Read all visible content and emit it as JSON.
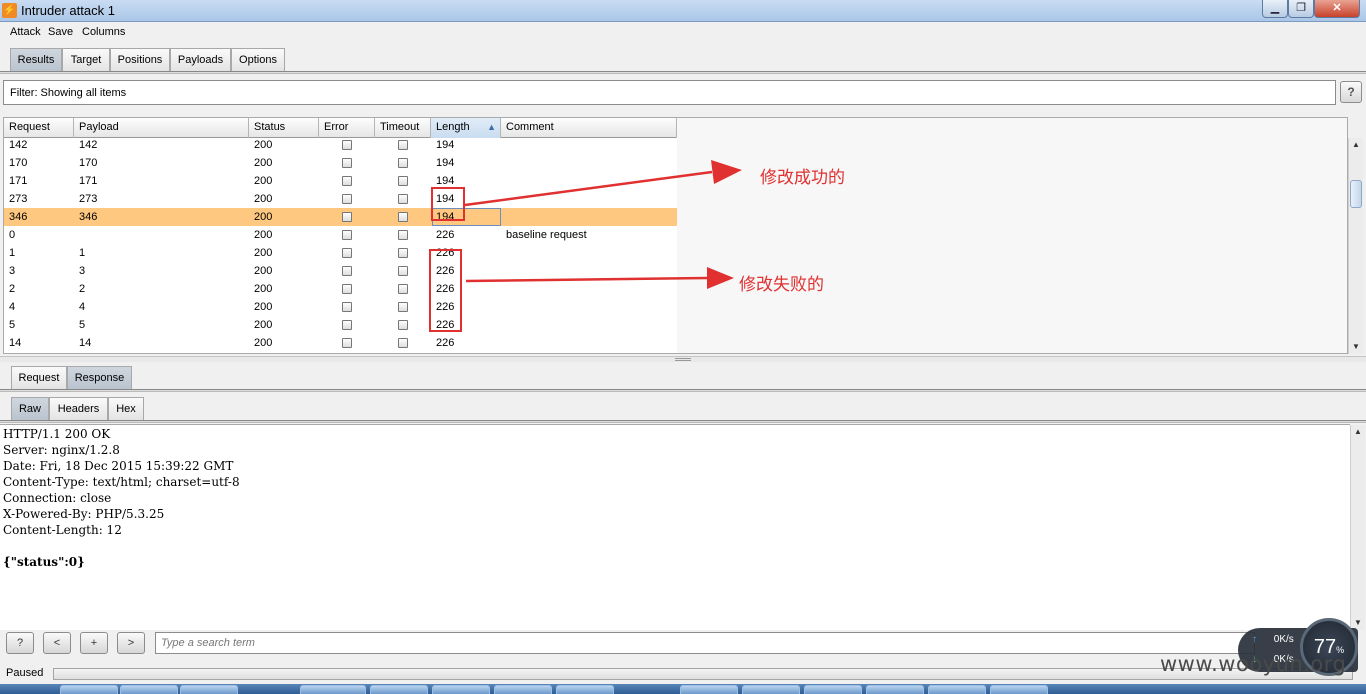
{
  "window": {
    "title": "Intruder attack 1",
    "min_icon": "minimize-icon",
    "max_icon": "maximize-icon",
    "close_icon": "close-icon"
  },
  "menu": [
    "Attack",
    "Save",
    "Columns"
  ],
  "top_tabs": [
    {
      "label": "Results",
      "active": true
    },
    {
      "label": "Target",
      "active": false
    },
    {
      "label": "Positions",
      "active": false
    },
    {
      "label": "Payloads",
      "active": false
    },
    {
      "label": "Options",
      "active": false
    }
  ],
  "filter": {
    "label": "Filter: Showing all items",
    "help": "?"
  },
  "table": {
    "columns": [
      "Request",
      "Payload",
      "Status",
      "Error",
      "Timeout",
      "Length",
      "Comment"
    ],
    "sorted_column": "Length",
    "sort_icon": "sort-ascending-icon",
    "rows": [
      {
        "request": "142",
        "payload": "142",
        "status": "200",
        "length": "194",
        "comment": ""
      },
      {
        "request": "170",
        "payload": "170",
        "status": "200",
        "length": "194",
        "comment": ""
      },
      {
        "request": "171",
        "payload": "171",
        "status": "200",
        "length": "194",
        "comment": ""
      },
      {
        "request": "273",
        "payload": "273",
        "status": "200",
        "length": "194",
        "comment": ""
      },
      {
        "request": "346",
        "payload": "346",
        "status": "200",
        "length": "194",
        "comment": "",
        "selected": true
      },
      {
        "request": "0",
        "payload": "",
        "status": "200",
        "length": "226",
        "comment": "baseline request"
      },
      {
        "request": "1",
        "payload": "1",
        "status": "200",
        "length": "226",
        "comment": ""
      },
      {
        "request": "3",
        "payload": "3",
        "status": "200",
        "length": "226",
        "comment": ""
      },
      {
        "request": "2",
        "payload": "2",
        "status": "200",
        "length": "226",
        "comment": ""
      },
      {
        "request": "4",
        "payload": "4",
        "status": "200",
        "length": "226",
        "comment": ""
      },
      {
        "request": "5",
        "payload": "5",
        "status": "200",
        "length": "226",
        "comment": ""
      },
      {
        "request": "14",
        "payload": "14",
        "status": "200",
        "length": "226",
        "comment": ""
      }
    ]
  },
  "annotations": {
    "success": "修改成功的",
    "fail": "修改失败的",
    "color": "#e03030"
  },
  "detail_tabs": [
    {
      "label": "Request",
      "active": false
    },
    {
      "label": "Response",
      "active": true
    }
  ],
  "view_tabs": [
    {
      "label": "Raw",
      "active": true
    },
    {
      "label": "Headers",
      "active": false
    },
    {
      "label": "Hex",
      "active": false
    }
  ],
  "response": {
    "lines": [
      "HTTP/1.1 200 OK",
      "Server: nginx/1.2.8",
      "Date: Fri, 18 Dec 2015 15:39:22 GMT",
      "Content-Type: text/html; charset=utf-8",
      "Connection: close",
      "X-Powered-By: PHP/5.3.25",
      "Content-Length: 12"
    ],
    "body": "{\"status\":0}"
  },
  "search": {
    "help": "?",
    "prev": "<",
    "add": "+",
    "next": ">",
    "placeholder": "Type a search term"
  },
  "status": {
    "text": "Paused"
  },
  "netmon": {
    "up": "0K/s",
    "down": "0K/s",
    "percent": "77",
    "percent_sign": "%"
  },
  "watermark": "www.wooyun.org"
}
